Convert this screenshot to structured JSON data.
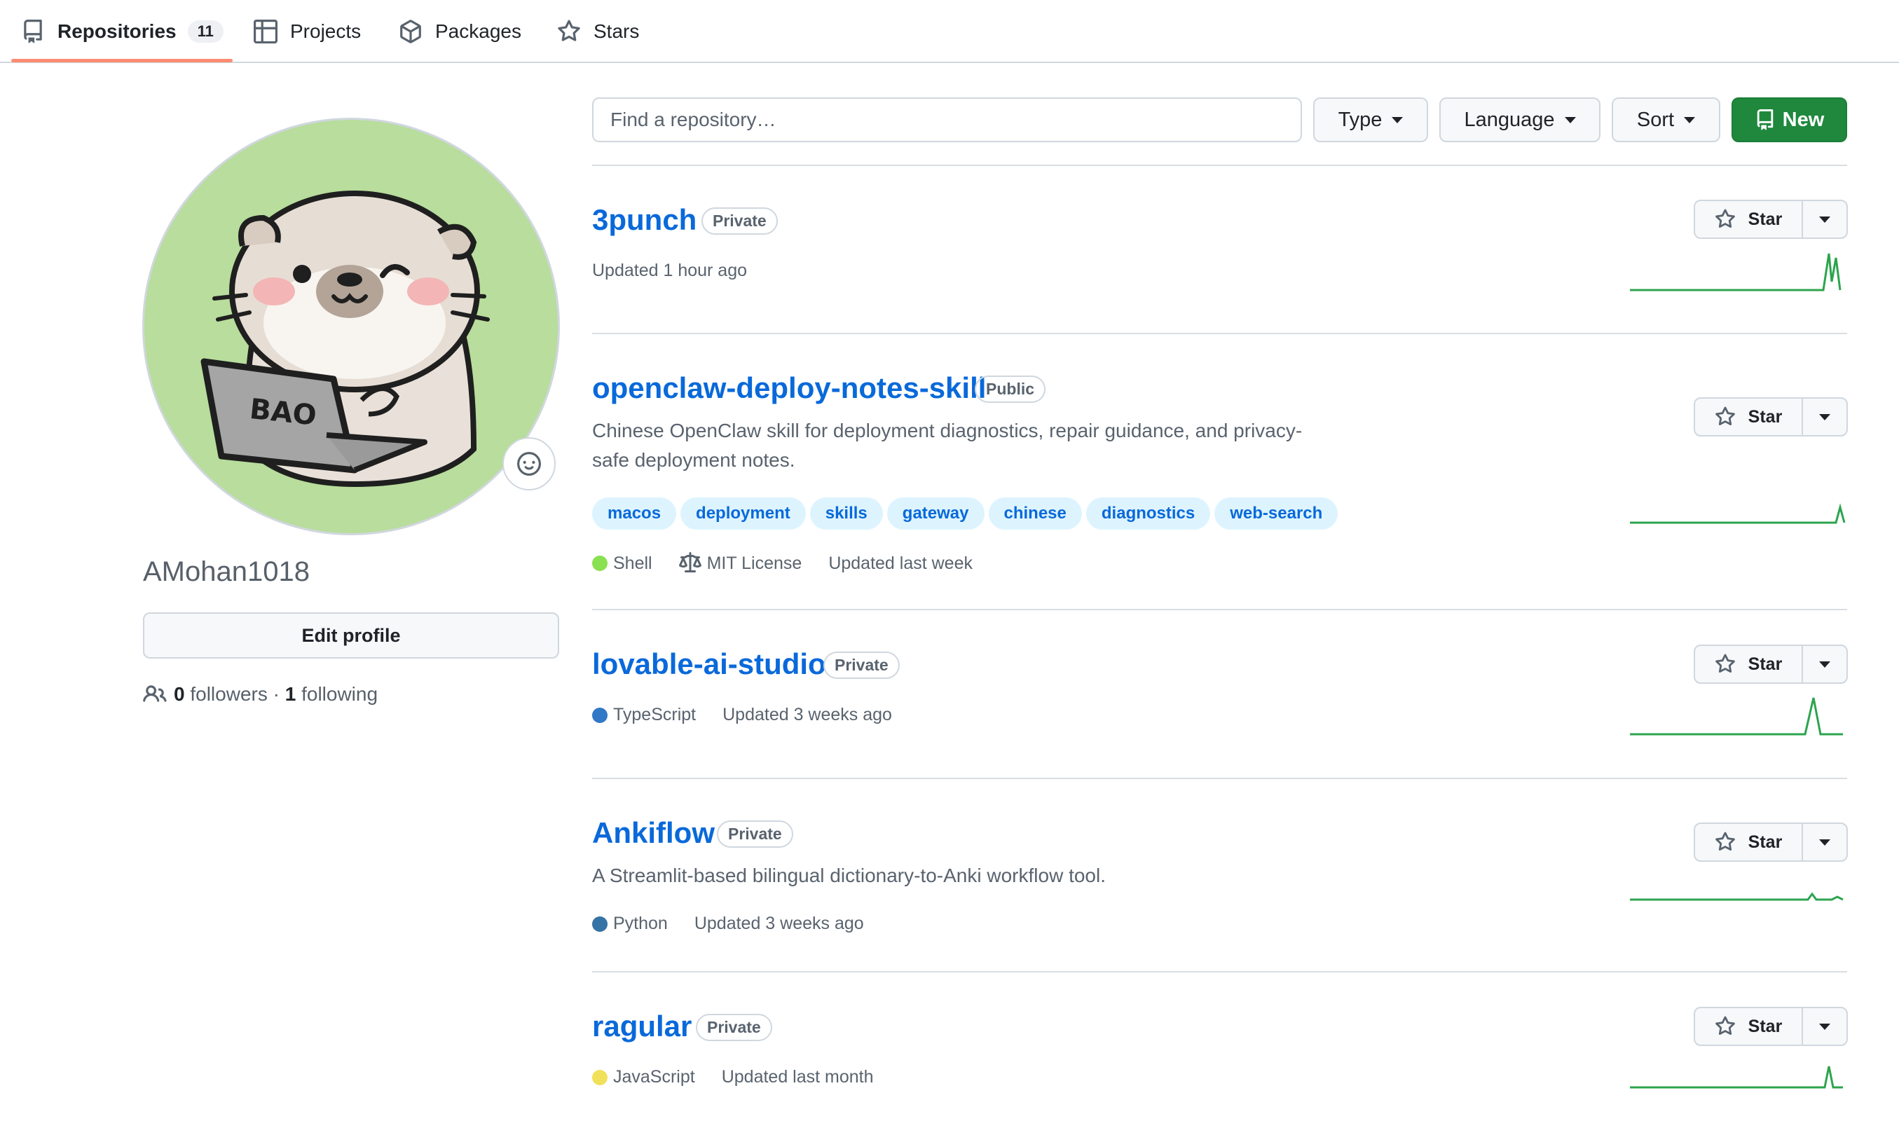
{
  "nav": {
    "tabs": [
      {
        "label": "Repositories",
        "count": "11",
        "icon": "repo-icon",
        "active": true
      },
      {
        "label": "Projects",
        "icon": "table-icon"
      },
      {
        "label": "Packages",
        "icon": "package-icon"
      },
      {
        "label": "Stars",
        "icon": "star-icon"
      }
    ]
  },
  "profile": {
    "username": "AMohan1018",
    "avatar_text": "BAO",
    "edit_label": "Edit profile",
    "followers_count": "0",
    "followers_label": "followers",
    "separator": "·",
    "following_count": "1",
    "following_label": "following"
  },
  "filters": {
    "search_placeholder": "Find a repository…",
    "type_label": "Type",
    "language_label": "Language",
    "sort_label": "Sort",
    "new_label": "New"
  },
  "colors": {
    "accent": "#0969da",
    "new_button": "#1f883d",
    "tab_underline": "#fd8c73",
    "spark": "#2da44e"
  },
  "repos": [
    {
      "name": "3punch",
      "visibility": "Private",
      "updated": "Updated 1 hour ago",
      "star_label": "Star"
    },
    {
      "name": "openclaw-deploy-notes-skill",
      "visibility": "Public",
      "description": "Chinese OpenClaw skill for deployment diagnostics, repair guidance, and privacy-safe deployment notes.",
      "topics": [
        "macos",
        "deployment",
        "skills",
        "gateway",
        "chinese",
        "diagnostics",
        "web-search"
      ],
      "language": "Shell",
      "language_color": "#89e051",
      "license": "MIT License",
      "updated": "Updated last week",
      "star_label": "Star"
    },
    {
      "name": "lovable-ai-studio",
      "visibility": "Private",
      "language": "TypeScript",
      "language_color": "#3178c6",
      "updated": "Updated 3 weeks ago",
      "star_label": "Star"
    },
    {
      "name": "Ankiflow",
      "visibility": "Private",
      "description": "A Streamlit-based bilingual dictionary-to-Anki workflow tool.",
      "language": "Python",
      "language_color": "#3572A5",
      "updated": "Updated 3 weeks ago",
      "star_label": "Star"
    },
    {
      "name": "ragular",
      "visibility": "Private",
      "language": "JavaScript",
      "language_color": "#f1e05a",
      "updated": "Updated last month",
      "star_label": "Star"
    }
  ]
}
